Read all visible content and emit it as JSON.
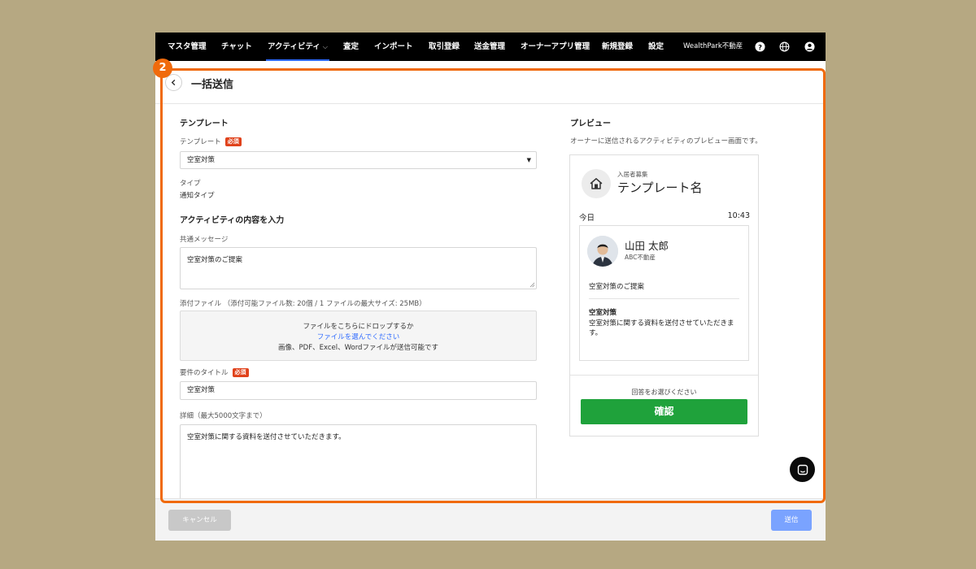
{
  "nav": {
    "items": [
      "マスタ管理",
      "チャット",
      "アクティビティ",
      "査定",
      "インポート",
      "取引登録",
      "送金管理",
      "オーナーアプリ管理",
      "新規登録",
      "設定"
    ],
    "active": "アクティビティ",
    "brand": "WealthPark不動産",
    "accent_color": "#2f6bff"
  },
  "header": {
    "title": "一括送信"
  },
  "form": {
    "template_section": "テンプレート",
    "template_label": "テンプレート",
    "required_badge": "必須",
    "template_value": "空室対策",
    "type_label": "タイプ",
    "type_value": "通知タイプ",
    "content_section": "アクティビティの内容を入力",
    "common_message_label": "共通メッセージ",
    "common_message_value": "空室対策のご提案",
    "attachment_label": "添付ファイル （添付可能ファイル数: 20個 / 1 ファイルの最大サイズ: 25MB）",
    "dropzone": {
      "line1": "ファイルをこちらにドロップするか",
      "link": "ファイルを選んでください",
      "line3": "画像、PDF、Excel、Wordファイルが送信可能です"
    },
    "title_label": "要件のタイトル",
    "title_value": "空室対策",
    "detail_label": "詳細（最大5000文字まで）",
    "detail_value": "空室対策に関する資料を送付させていただきます。"
  },
  "preview": {
    "section": "プレビュー",
    "description": "オーナーに送信されるアクティビティのプレビュー画面です。",
    "category": "入居者募集",
    "template_name": "テンプレート名",
    "day": "今日",
    "time": "10:43",
    "sender": "山田 太郎",
    "company": "ABC不動産",
    "message": "空室対策のご提案",
    "title": "空室対策",
    "detail": "空室対策に関する資料を送付させていただきます。",
    "prompt": "回答をお選びください",
    "confirm": "確認",
    "confirm_color": "#1fa23b"
  },
  "footer": {
    "cancel": "キャンセル",
    "send": "送信"
  },
  "annotation": {
    "step": "2",
    "color": "#f06a0c"
  }
}
